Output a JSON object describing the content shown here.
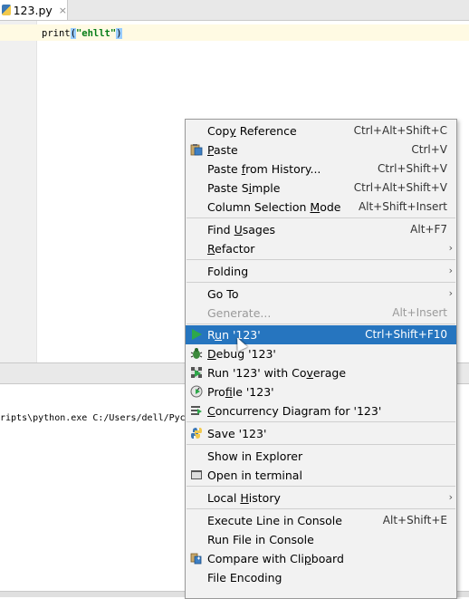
{
  "editor_tab": {
    "title": "123.py",
    "close": "×"
  },
  "code": {
    "func": "print",
    "open": "(",
    "string": "\"ehllt\"",
    "close": ")"
  },
  "console": {
    "line": "ripts\\python.exe C:/Users/dell/Pych"
  },
  "colors": {
    "selection": "#2675bf",
    "run_icon": "#2ea84a"
  },
  "menu": {
    "items": [
      {
        "label": "Copy Reference",
        "shortcut": "Ctrl+Alt+Shift+C",
        "icon": ""
      },
      {
        "label": "Paste",
        "shortcut": "Ctrl+V",
        "icon": "paste-icon"
      },
      {
        "label": "Paste from History...",
        "shortcut": "Ctrl+Shift+V",
        "icon": ""
      },
      {
        "label": "Paste Simple",
        "shortcut": "Ctrl+Alt+Shift+V",
        "icon": ""
      },
      {
        "label": "Column Selection Mode",
        "shortcut": "Alt+Shift+Insert",
        "icon": ""
      },
      {
        "label": "Find Usages",
        "shortcut": "Alt+F7",
        "icon": ""
      },
      {
        "label": "Refactor",
        "shortcut": "",
        "icon": "",
        "submenu": true
      },
      {
        "label": "Folding",
        "shortcut": "",
        "icon": "",
        "submenu": true
      },
      {
        "label": "Go To",
        "shortcut": "",
        "icon": "",
        "submenu": true
      },
      {
        "label": "Generate...",
        "shortcut": "Alt+Insert",
        "icon": "",
        "disabled": true
      },
      {
        "label": "Run '123'",
        "shortcut": "Ctrl+Shift+F10",
        "icon": "run-icon",
        "selected": true
      },
      {
        "label": "Debug '123'",
        "shortcut": "",
        "icon": "debug-icon"
      },
      {
        "label": "Run '123' with Coverage",
        "shortcut": "",
        "icon": "coverage-icon"
      },
      {
        "label": "Profile '123'",
        "shortcut": "",
        "icon": "profile-icon"
      },
      {
        "label": "Concurrency Diagram for '123'",
        "shortcut": "",
        "icon": "concurrency-icon"
      },
      {
        "label": "Save '123'",
        "shortcut": "",
        "icon": "python-icon"
      },
      {
        "label": "Show in Explorer",
        "shortcut": "",
        "icon": ""
      },
      {
        "label": "Open in terminal",
        "shortcut": "",
        "icon": "terminal-icon"
      },
      {
        "label": "Local History",
        "shortcut": "",
        "icon": "",
        "submenu": true
      },
      {
        "label": "Execute Line in Console",
        "shortcut": "Alt+Shift+E",
        "icon": ""
      },
      {
        "label": "Run File in Console",
        "shortcut": "",
        "icon": ""
      },
      {
        "label": "Compare with Clipboard",
        "shortcut": "",
        "icon": "compare-icon"
      },
      {
        "label": "File Encoding",
        "shortcut": "",
        "icon": ""
      }
    ]
  }
}
